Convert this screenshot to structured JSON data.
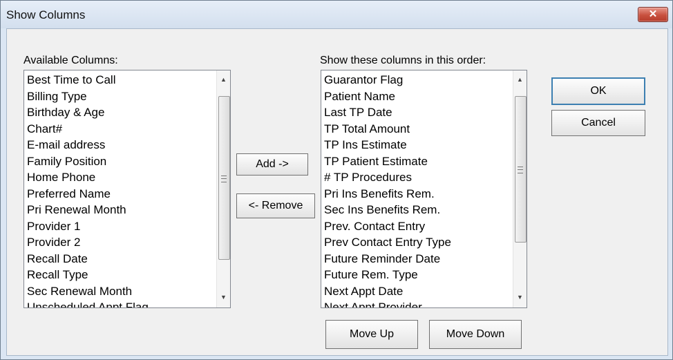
{
  "window": {
    "title": "Show Columns",
    "close_glyph": "✕"
  },
  "available": {
    "label": "Available Columns:",
    "items": [
      "Best Time to Call",
      "Billing Type",
      "Birthday & Age",
      "Chart#",
      "E-mail address",
      "Family Position",
      "Home Phone",
      "Preferred Name",
      "Pri Renewal Month",
      "Provider 1",
      "Provider 2",
      "Recall Date",
      "Recall Type",
      "Sec Renewal Month",
      "Unscheduled Appt Flag"
    ]
  },
  "shown": {
    "label": "Show these columns in this order:",
    "items": [
      "Guarantor Flag",
      "Patient Name",
      "Last TP Date",
      "TP Total Amount",
      "TP Ins Estimate",
      "TP Patient Estimate",
      "# TP Procedures",
      "Pri Ins Benefits Rem.",
      "Sec Ins Benefits Rem.",
      "Prev. Contact Entry",
      "Prev Contact Entry Type",
      "Future Reminder Date",
      "Future Rem. Type",
      "Next Appt Date",
      "Next Appt Provider"
    ]
  },
  "buttons": {
    "add": "Add ->",
    "remove": "<- Remove",
    "ok": "OK",
    "cancel": "Cancel",
    "move_up": "Move Up",
    "move_down": "Move Down"
  },
  "icons": {
    "scroll_up": "▲",
    "scroll_down": "▼"
  },
  "colors": {
    "close_button": "#c8503e",
    "dialog_face": "#f0f0f0",
    "title_bar": "#dbe6f3"
  }
}
